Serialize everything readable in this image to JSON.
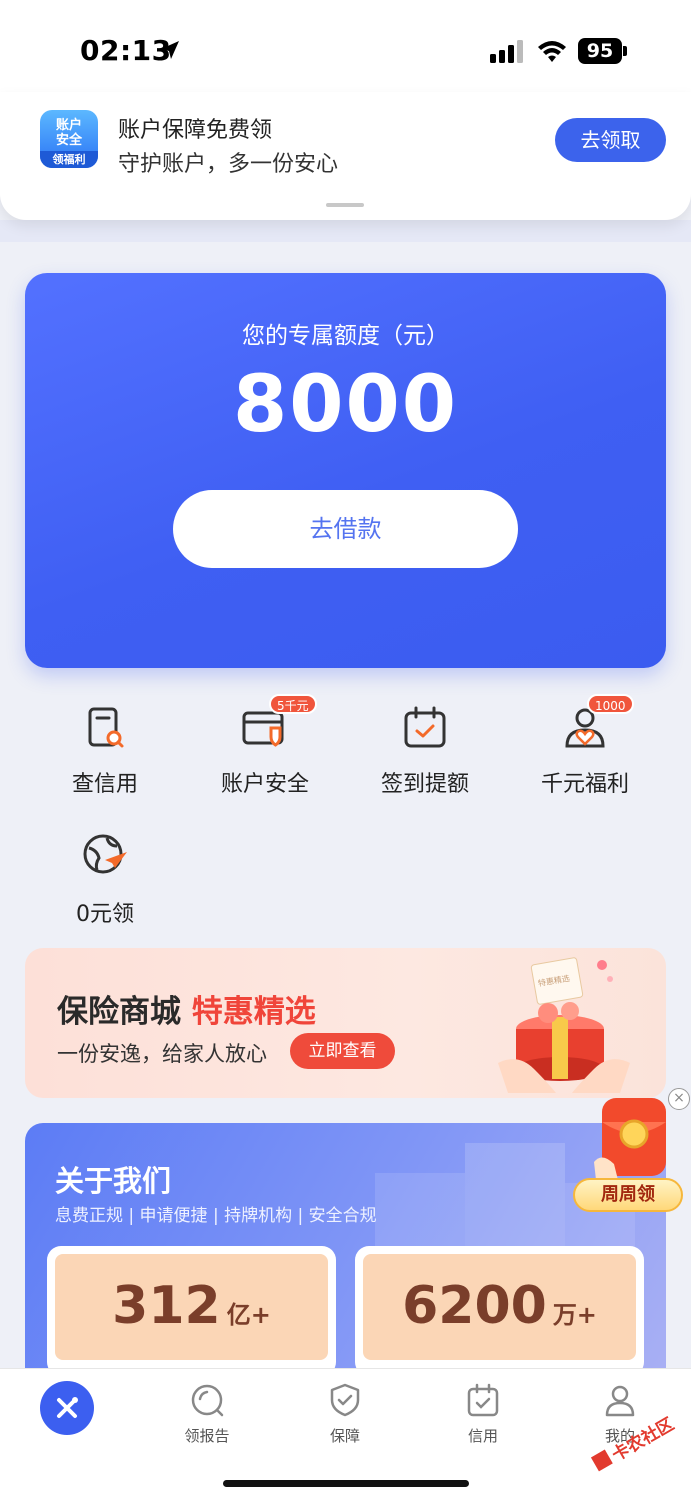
{
  "status_bar": {
    "time": "02:13",
    "battery": "95"
  },
  "notification": {
    "app_icon_top": "账户\n安全",
    "app_icon_bottom": "领福利",
    "title": "账户保障免费领",
    "subtitle": "守护账户，多一份安心",
    "button": "去领取"
  },
  "quota": {
    "label": "您的专属额度（元）",
    "amount": "8000",
    "button": "去借款"
  },
  "shortcuts": [
    {
      "label": "查信用",
      "icon": "credit-check-icon"
    },
    {
      "label": "账户安全",
      "icon": "account-security-icon",
      "badge": "5千元"
    },
    {
      "label": "签到提额",
      "icon": "calendar-check-icon"
    },
    {
      "label": "千元福利",
      "icon": "user-heart-icon",
      "badge": "1000"
    },
    {
      "label": "0元领",
      "icon": "globe-plane-icon"
    }
  ],
  "insurance": {
    "title_a": "保险商城",
    "title_b": "特惠精选",
    "subtitle": "一份安逸，给家人放心",
    "button": "立即查看",
    "gift_tag": "特惠精选"
  },
  "about": {
    "title": "关于我们",
    "tags": "息费正规 | 申请便捷 | 持牌机构 | 安全合规",
    "stats": [
      {
        "value": "312",
        "unit": "亿+"
      },
      {
        "value": "6200",
        "unit": "万+"
      }
    ]
  },
  "floating": {
    "label": "周周领",
    "close": "×"
  },
  "nav": {
    "items": [
      {
        "label": "",
        "icon": "home-logo-icon"
      },
      {
        "label": "领报告",
        "icon": "report-icon"
      },
      {
        "label": "保障",
        "icon": "shield-check-icon"
      },
      {
        "label": "信用",
        "icon": "calendar-check-icon"
      },
      {
        "label": "我的",
        "icon": "user-icon"
      }
    ]
  },
  "watermark": "卡农社区",
  "colors": {
    "primary": "#3c63ec",
    "accent_red": "#f0453a",
    "stat_brown": "#7a3e2a"
  }
}
